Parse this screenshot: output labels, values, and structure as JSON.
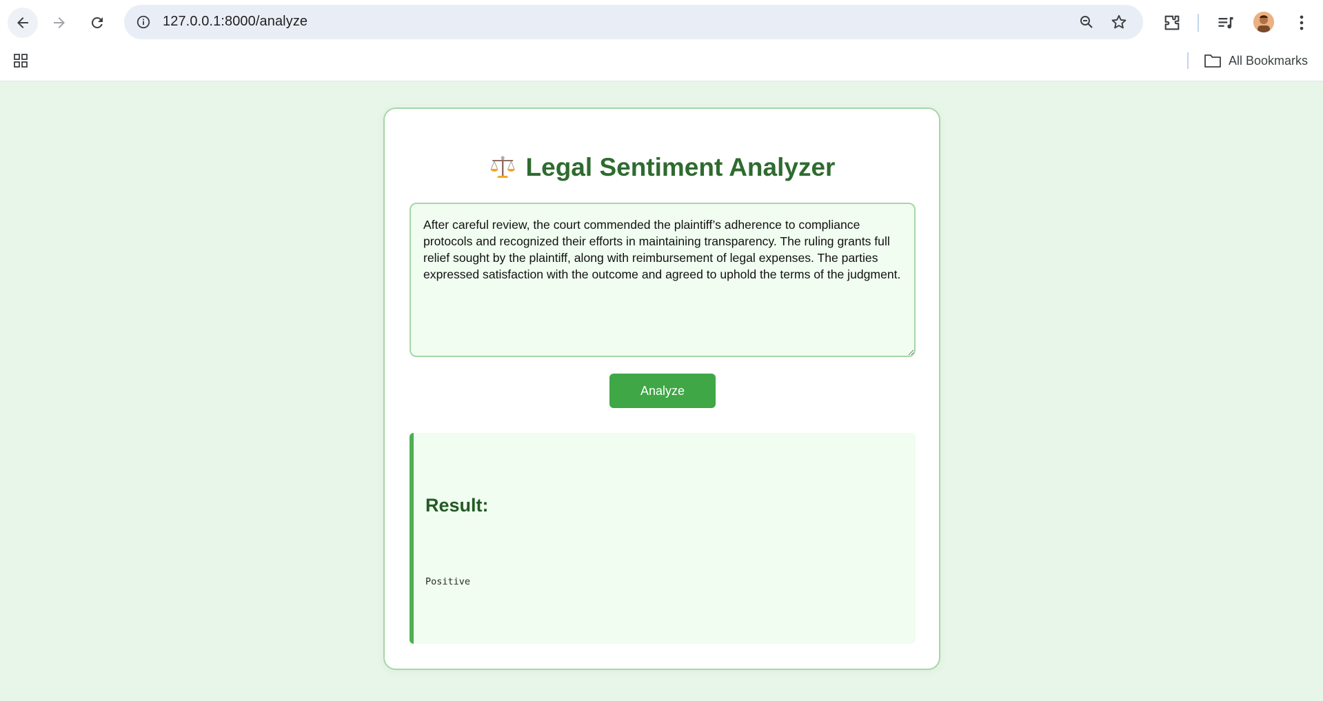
{
  "browser": {
    "url": "127.0.0.1:8000/analyze",
    "bookmarks_label": "All Bookmarks"
  },
  "page": {
    "title": "Legal Sentiment Analyzer",
    "title_icon": "scales-icon",
    "input_text": "After careful review, the court commended the plaintiff’s adherence to compliance protocols and recognized their efforts in maintaining transparency. The ruling grants full relief sought by the plaintiff, along with reimbursement of legal expenses. The parties expressed satisfaction with the outcome and agreed to uphold the terms of the judgment.",
    "analyze_label": "Analyze",
    "result_heading": "Result:",
    "result_value": "Positive"
  },
  "colors": {
    "page_background": "#e8f5e9",
    "accent_green": "#3fa745",
    "title_green": "#2e6b2f",
    "border_green": "#a5d6a7"
  }
}
